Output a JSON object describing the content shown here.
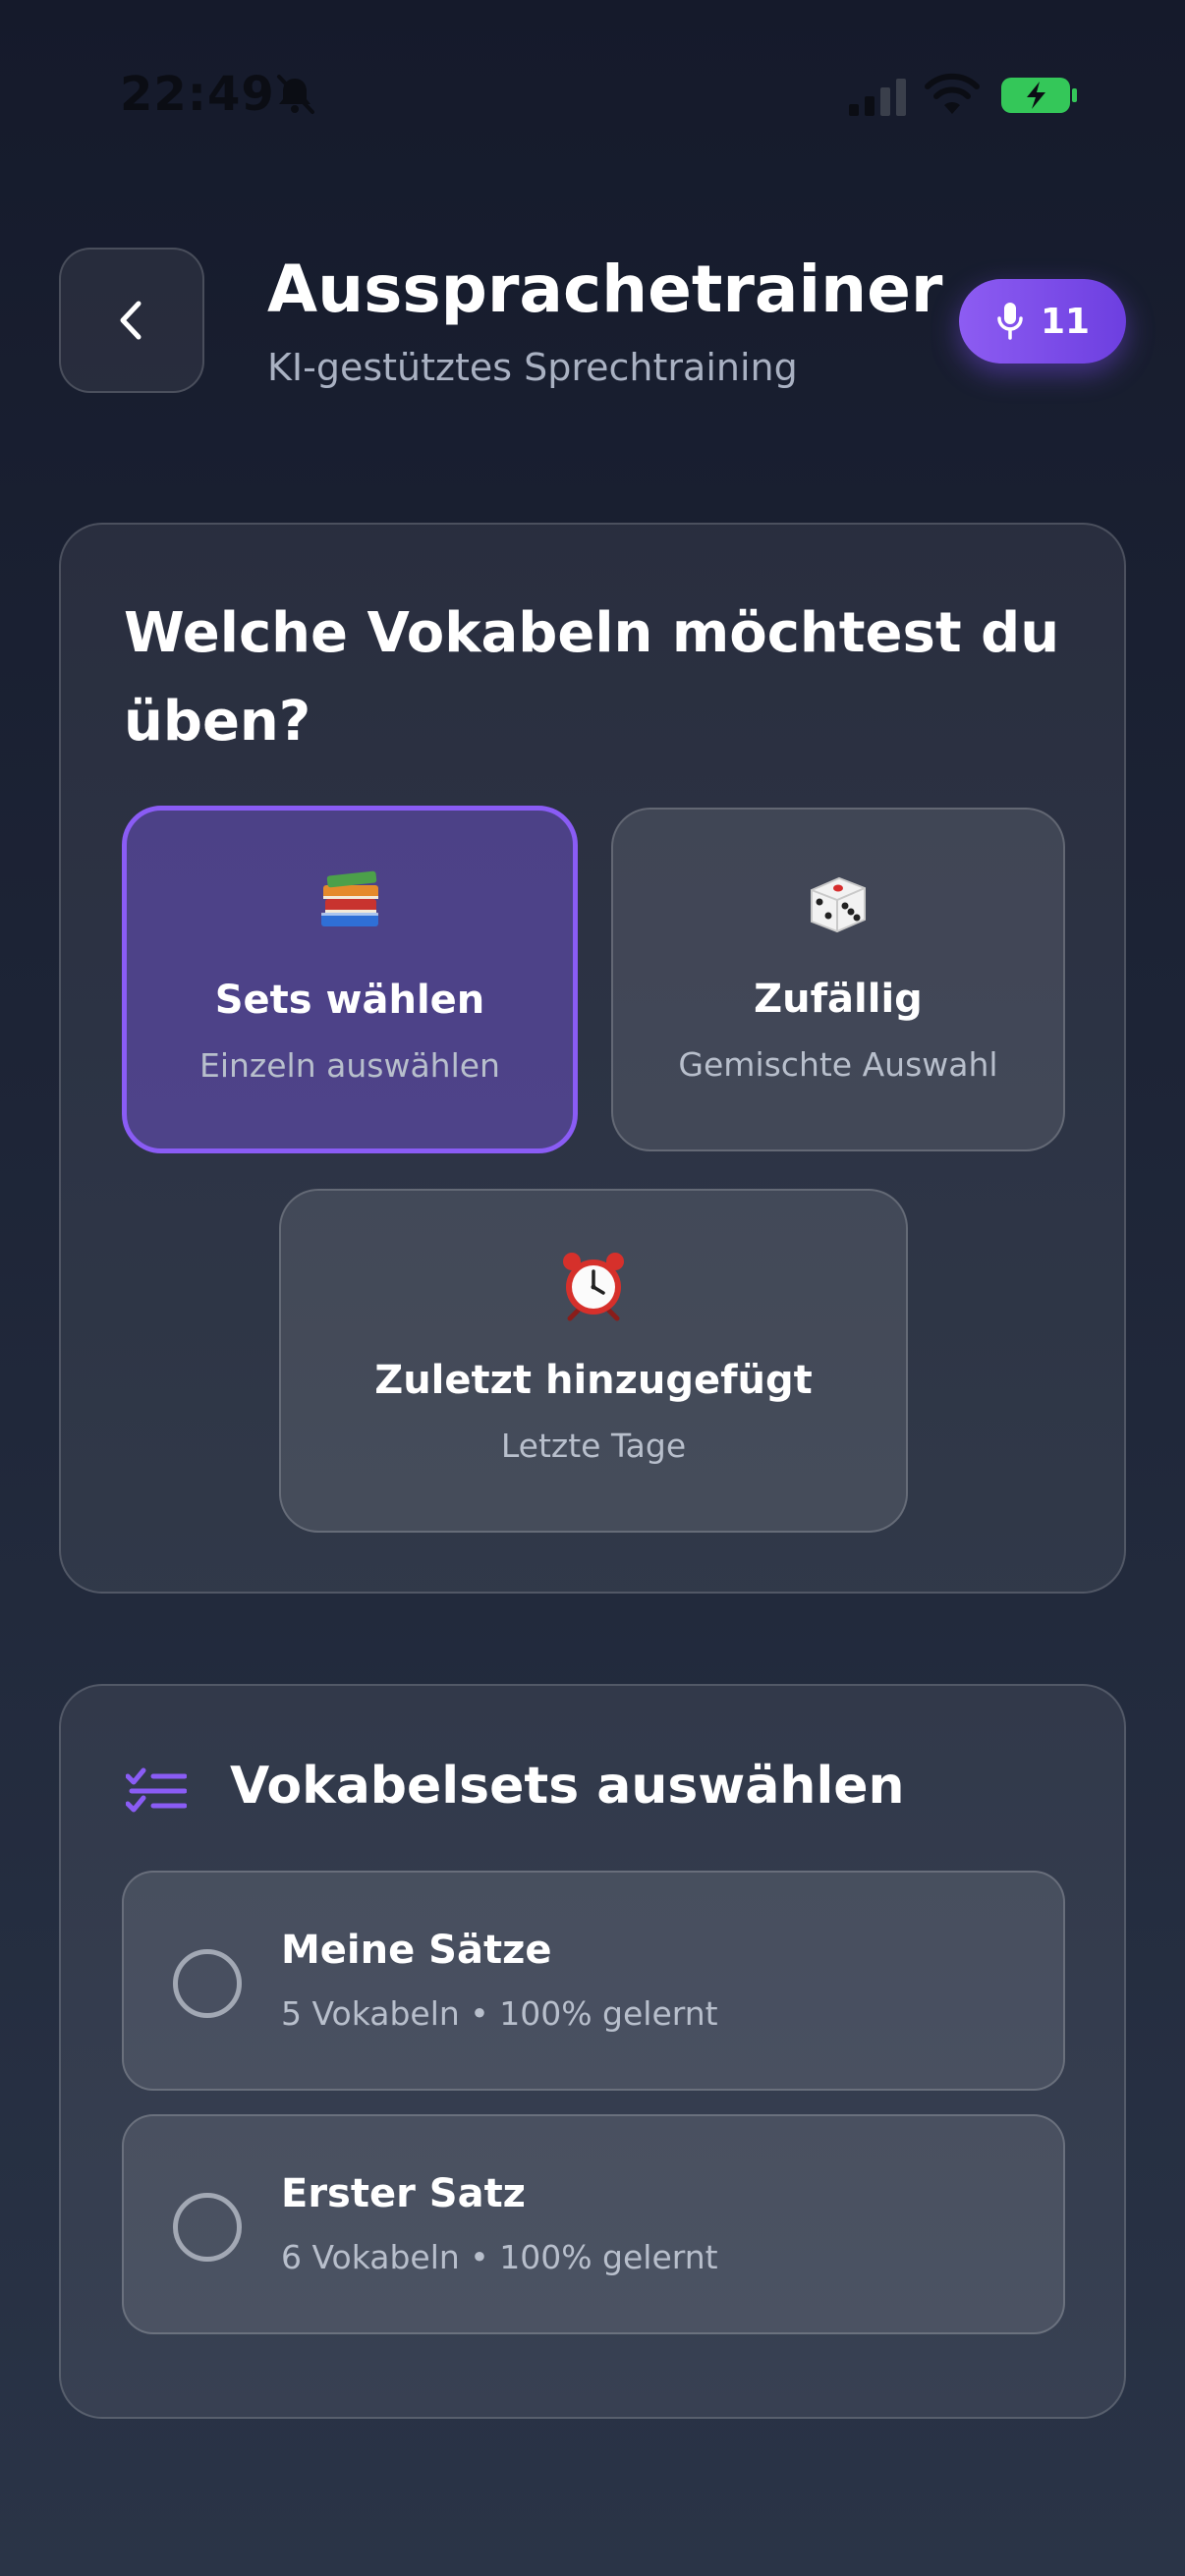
{
  "status_bar": {
    "time": "22:49",
    "icons": [
      "bell-muted-icon",
      "signal-icon",
      "wifi-icon",
      "battery-charging-icon"
    ],
    "battery_color": "#34c759"
  },
  "header": {
    "title": "Aussprachetrainer",
    "subtitle": "KI-gestütztes Sprechtraining",
    "credits": "11",
    "credits_icon": "microphone-icon",
    "accent_color": "#7c4df0"
  },
  "mode_selection": {
    "heading": "Welche Vokabeln möchtest du üben?",
    "options": [
      {
        "emoji": "books-emoji",
        "title": "Sets wählen",
        "subtitle": "Einzeln auswählen",
        "selected": true
      },
      {
        "emoji": "dice-emoji",
        "title": "Zufällig",
        "subtitle": "Gemischte Auswahl",
        "selected": false
      },
      {
        "emoji": "alarm-clock-emoji",
        "title": "Zuletzt hinzugefügt",
        "subtitle": "Letzte Tage",
        "selected": false
      }
    ]
  },
  "sets_section": {
    "heading": "Vokabelsets auswählen",
    "heading_icon": "checklist-icon",
    "items": [
      {
        "name": "Meine Sätze",
        "meta": "5 Vokabeln • 100% gelernt",
        "checked": false
      },
      {
        "name": "Erster Satz",
        "meta": "6 Vokabeln • 100% gelernt",
        "checked": false
      }
    ]
  }
}
